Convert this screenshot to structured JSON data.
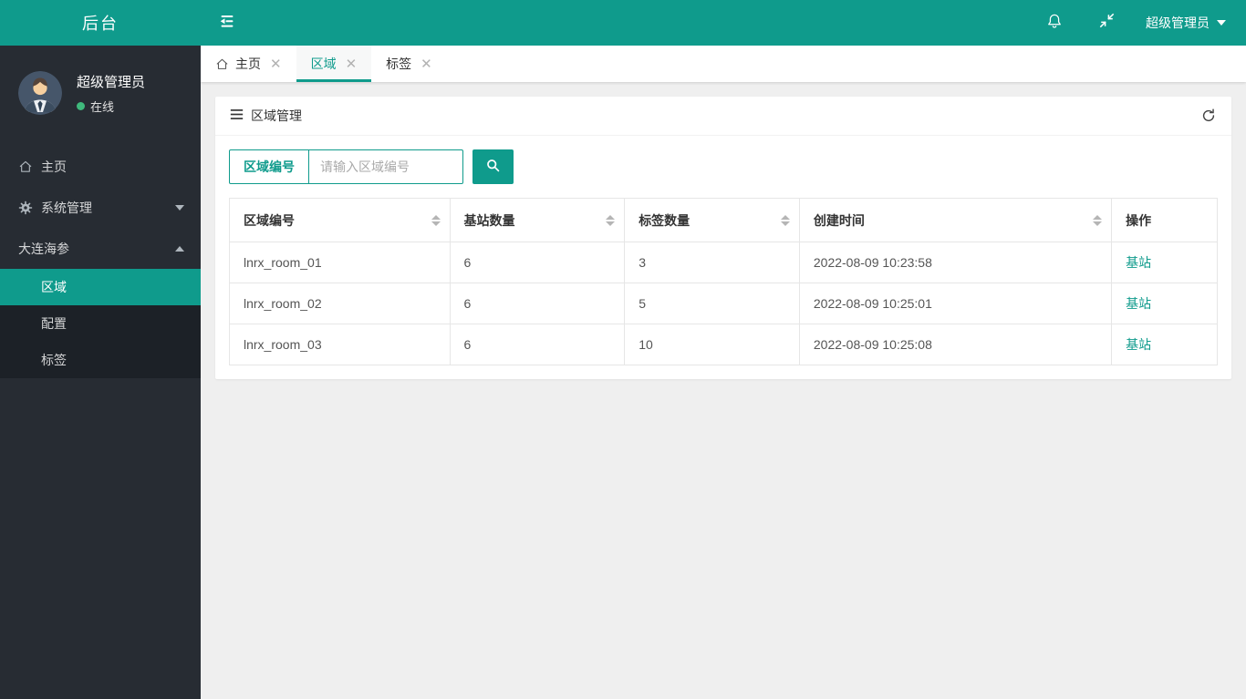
{
  "theme": {
    "accent": "#0f9b8c",
    "sidebar_bg": "#272c33",
    "submenu_bg": "#1c2127",
    "content_bg": "#efefef",
    "online_green": "#3fb97c",
    "border_gray": "#e6e6e6"
  },
  "topbar": {
    "logo": "后台",
    "user_label": "超级管理员"
  },
  "sidebar": {
    "user": {
      "name": "超级管理员",
      "status": "在线"
    },
    "menu": [
      {
        "label": "主页",
        "icon": "home-icon"
      },
      {
        "label": "系统管理",
        "icon": "gear-icon",
        "state": "collapsed"
      },
      {
        "label": "大连海参",
        "state": "expanded",
        "children": [
          {
            "label": "区域",
            "active": true
          },
          {
            "label": "配置",
            "active": false
          },
          {
            "label": "标签",
            "active": false
          }
        ]
      }
    ]
  },
  "tabs": [
    {
      "label": "主页",
      "icon": "home-icon",
      "closable": true,
      "active": false
    },
    {
      "label": "区域",
      "closable": true,
      "active": true
    },
    {
      "label": "标签",
      "closable": true,
      "active": false
    }
  ],
  "panel": {
    "title": "区域管理"
  },
  "search": {
    "field_label": "区域编号",
    "placeholder": "请输入区域编号"
  },
  "table": {
    "columns": [
      {
        "label": "区域编号",
        "sortable": true
      },
      {
        "label": "基站数量",
        "sortable": true
      },
      {
        "label": "标签数量",
        "sortable": true
      },
      {
        "label": "创建时间",
        "sortable": true
      },
      {
        "label": "操作",
        "sortable": false
      }
    ],
    "rows": [
      {
        "region": "lnrx_room_01",
        "stations": "6",
        "tags": "3",
        "created": "2022-08-09 10:23:58",
        "action": "基站"
      },
      {
        "region": "lnrx_room_02",
        "stations": "6",
        "tags": "5",
        "created": "2022-08-09 10:25:01",
        "action": "基站"
      },
      {
        "region": "lnrx_room_03",
        "stations": "6",
        "tags": "10",
        "created": "2022-08-09 10:25:08",
        "action": "基站"
      }
    ]
  }
}
